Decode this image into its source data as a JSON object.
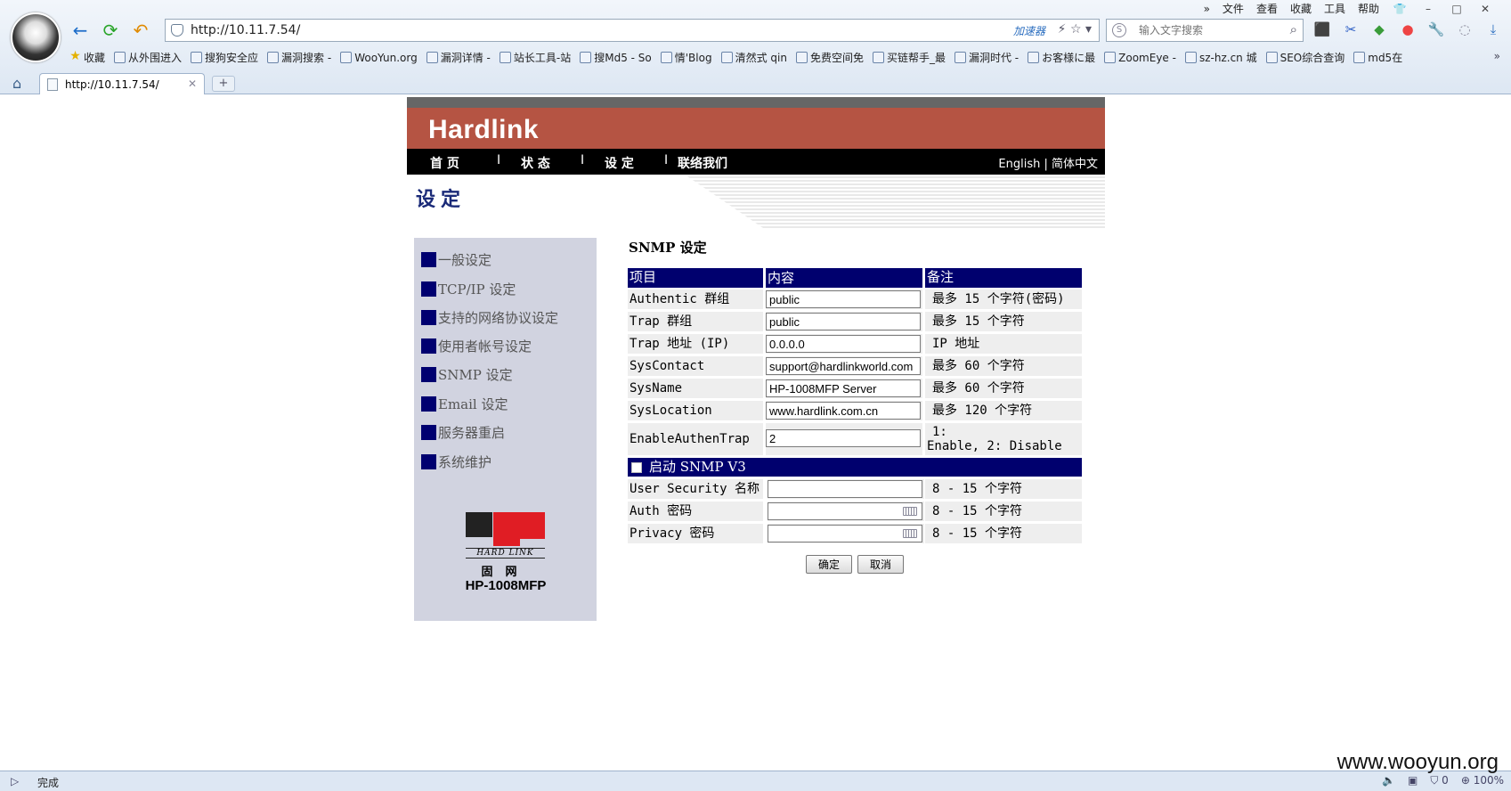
{
  "browser": {
    "menu": [
      "文件",
      "查看",
      "收藏",
      "工具",
      "帮助"
    ],
    "url": "http://10.11.7.54/",
    "accelerator": "加速器",
    "search_placeholder": "输入文字搜索",
    "favorites": [
      "收藏",
      "从外围进入",
      "搜狗安全应",
      "漏洞搜索 -",
      "WooYun.org",
      "漏洞详情 -",
      "站长工具-站",
      "搜Md5 - So",
      "情'Blog",
      "清然式 qin",
      "免费空间免",
      "买链帮手_最",
      "漏洞时代 -",
      "お客様に最",
      "ZoomEye -",
      "sz-hz.cn 城",
      "SEO综合查询",
      "md5在"
    ],
    "tab_title": "http://10.11.7.54/",
    "status_text": "完成",
    "zoom": "100%",
    "status_count": "0"
  },
  "header": {
    "logo": "Hardlink",
    "nav": [
      "首 页",
      "状 态",
      "设 定",
      "联络我们"
    ],
    "nav_sep": "I",
    "lang": "English | 简体中文",
    "section_title": "设定"
  },
  "sidebar": {
    "items": [
      "一般设定",
      "TCP/IP 设定",
      "支持的网络协议设定",
      "使用者帐号设定",
      "SNMP 设定",
      "Email 设定",
      "服务器重启",
      "系统维护"
    ],
    "logo_line": "HARD LINK",
    "logo_cn": "固网",
    "model": "HP-1008MFP"
  },
  "snmp": {
    "title": "SNMP 设定",
    "headers": [
      "项目",
      "内容",
      "备注"
    ],
    "rows": [
      {
        "label": "Authentic 群组",
        "value": "public",
        "note": "最多 15 个字符(密码)"
      },
      {
        "label": "Trap 群组",
        "value": "public",
        "note": "最多 15 个字符"
      },
      {
        "label": "Trap 地址 (IP)",
        "value": "0.0.0.0",
        "note": "IP 地址"
      },
      {
        "label": "SysContact",
        "value": "support@hardlinkworld.com",
        "note": "最多 60 个字符"
      },
      {
        "label": "SysName",
        "value": "HP-1008MFP Server",
        "note": "最多 60 个字符"
      },
      {
        "label": "SysLocation",
        "value": "www.hardlink.com.cn",
        "note": "最多 120 个字符"
      },
      {
        "label": "EnableAuthenTrap",
        "value": "2",
        "note1": "1:",
        "note2": "Enable, 2: Disable"
      }
    ],
    "v3_label": "启动 SNMP V3",
    "v3_rows": [
      {
        "label": "User Security 名称",
        "value": "",
        "note": "8 - 15 个字符"
      },
      {
        "label": "Auth 密码",
        "value": "",
        "note": "8 - 15 个字符"
      },
      {
        "label": "Privacy 密码",
        "value": "",
        "note": "8 - 15 个字符"
      }
    ],
    "ok_label": "确定",
    "cancel_label": "取消"
  },
  "watermark": "www.wooyun.org"
}
